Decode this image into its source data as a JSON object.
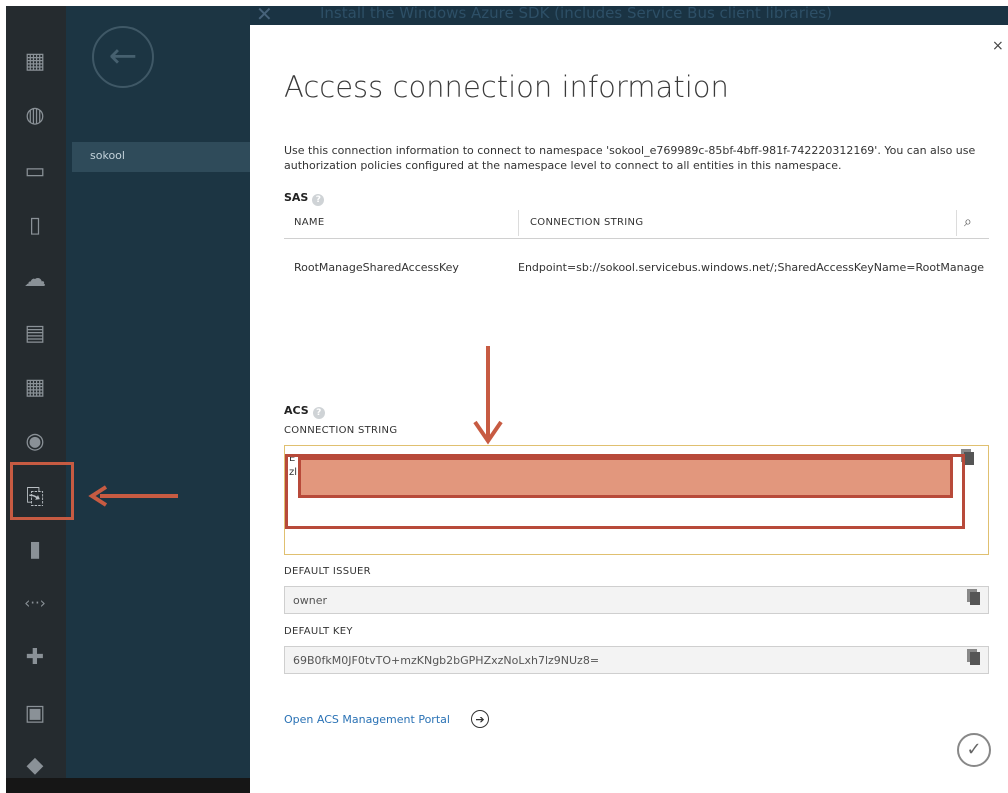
{
  "background": {
    "top_strip_text": "Install the Windows Azure SDK (includes Service Bus client libraries)",
    "nav_selected_item": "sokool",
    "back_icon": "back-arrow-icon",
    "rail_icons": [
      "grid-icon",
      "globe-icon",
      "monitor-icon",
      "mobile-icon",
      "cloud-icon",
      "database-icon",
      "table-icon",
      "media-icon",
      "service-bus-icon",
      "storage-icon",
      "code-icon",
      "network-icon",
      "store-icon",
      "diamond-icon"
    ]
  },
  "dialog": {
    "close_label": "×",
    "title": "Access connection information",
    "description": "Use this connection information to connect to namespace 'sokool_e769989c-85bf-4bff-981f-742220312169'. You can also use authorization policies configured at the namespace level to connect to all entities in this namespace.",
    "sas": {
      "label": "SAS",
      "help": "?",
      "columns": [
        "NAME",
        "CONNECTION STRING"
      ],
      "rows": [
        {
          "name": "RootManageSharedAccessKey",
          "connection_string": "Endpoint=sb://sokool.servicebus.windows.net/;SharedAccessKeyName=RootManage"
        }
      ]
    },
    "acs": {
      "label": "ACS",
      "help": "?",
      "connection_string_label": "CONNECTION STRING",
      "connection_string_value": "E\nzl",
      "default_issuer_label": "DEFAULT ISSUER",
      "default_issuer_value": "owner",
      "default_key_label": "DEFAULT KEY",
      "default_key_value": "69B0fkM0JF0tvTO+mzKNgb2bGPHZxzNoLxh7lz9NUz8=",
      "portal_link": "Open ACS Management Portal"
    }
  },
  "annotation_colors": {
    "arrow": "#c75b42",
    "highlight_fill": "#e2977d"
  }
}
